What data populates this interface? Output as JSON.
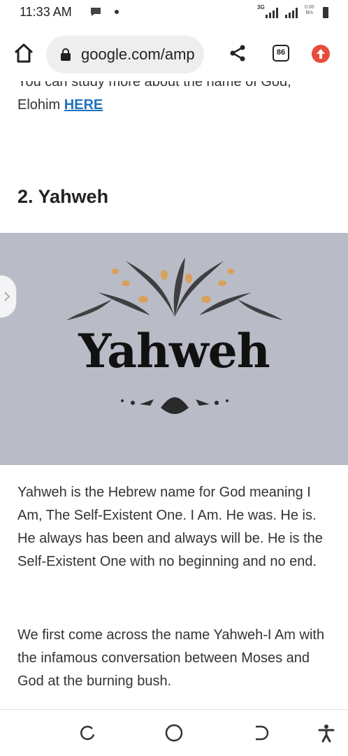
{
  "status_bar": {
    "time": "11:33 AM",
    "network": "3G",
    "speed_value": "0.00",
    "speed_unit": "B/s",
    "icons": [
      "message-icon",
      "notification-dot-icon",
      "signal-icon",
      "signal-icon",
      "battery-icon"
    ]
  },
  "browser": {
    "url": "google.com/amp",
    "tab_count": "86",
    "icons": [
      "home-icon",
      "lock-icon",
      "share-icon",
      "tabs-icon",
      "update-icon"
    ],
    "accent_color": "#e74c3c"
  },
  "article": {
    "intro_text": "You can study more about the name of God, Elohim ",
    "intro_link": "HERE",
    "heading": "2. Yahweh",
    "hero_word": "Yahweh",
    "hero_background": "#b9bcc6",
    "paragraph1": "Yahweh is the Hebrew name for God meaning I Am, The Self-Existent One. I Am. He was. He is. He always has been and always will be. He is the Self-Existent One with no beginning and no end.",
    "paragraph2": "We first come across the name Yahweh-I Am with the infamous conversation between Moses and God at the burning bush.",
    "link_color": "#1e73be"
  },
  "nav_bar": {
    "icons": [
      "recents-icon",
      "home-circle-icon",
      "back-icon",
      "accessibility-icon"
    ]
  }
}
